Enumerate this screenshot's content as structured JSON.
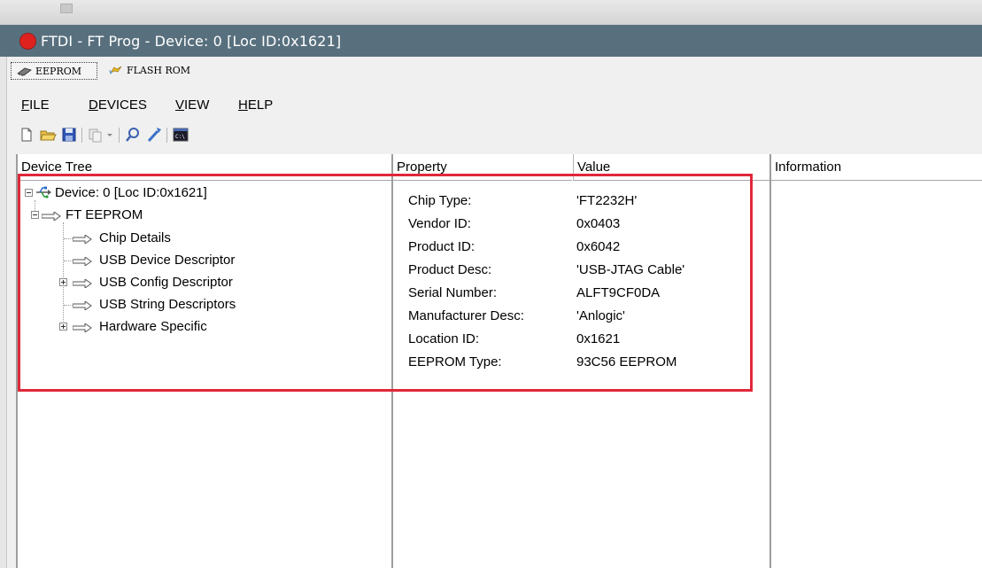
{
  "window": {
    "title": "FTDI - FT Prog - Device: 0 [Loc ID:0x1621]",
    "app_icon": "red-circle-icon"
  },
  "tabs": [
    {
      "label": "EEPROM",
      "icon": "eeprom-chip-icon",
      "active": true
    },
    {
      "label": "FLASH ROM",
      "icon": "flash-rom-icon",
      "active": false
    }
  ],
  "menu": [
    {
      "label": "FILE",
      "mnemonic": "F",
      "rest": "ILE"
    },
    {
      "label": "DEVICES",
      "mnemonic": "D",
      "rest": "EVICES"
    },
    {
      "label": "VIEW",
      "mnemonic": "V",
      "rest": "IEW"
    },
    {
      "label": "HELP",
      "mnemonic": "H",
      "rest": "ELP"
    }
  ],
  "toolbar": [
    "new-file-icon",
    "open-folder-icon",
    "save-disk-icon",
    "copy-icon",
    "dropdown-icon",
    "search-devices-icon",
    "program-wand-icon",
    "command-prompt-icon"
  ],
  "columns": {
    "device_tree": "Device Tree",
    "property": "Property",
    "value": "Value",
    "information": "Information"
  },
  "tree": {
    "device": "Device: 0 [Loc ID:0x1621]",
    "eeprom": "FT EEPROM",
    "children": [
      "Chip Details",
      "USB Device Descriptor",
      "USB Config Descriptor",
      "USB String Descriptors",
      "Hardware Specific"
    ]
  },
  "properties": [
    {
      "name": "Chip Type:",
      "value": "'FT2232H'"
    },
    {
      "name": "Vendor ID:",
      "value": "0x0403"
    },
    {
      "name": "Product ID:",
      "value": "0x6042"
    },
    {
      "name": "Product Desc:",
      "value": "'USB-JTAG Cable'"
    },
    {
      "name": "Serial Number:",
      "value": "ALFT9CF0DA"
    },
    {
      "name": "Manufacturer Desc:",
      "value": "'Anlogic'"
    },
    {
      "name": "Location ID:",
      "value": "0x1621"
    },
    {
      "name": "EEPROM Type:",
      "value": "93C56 EEPROM"
    }
  ],
  "colors": {
    "titlebar": "#58707e",
    "highlight_box": "#e0283a"
  }
}
